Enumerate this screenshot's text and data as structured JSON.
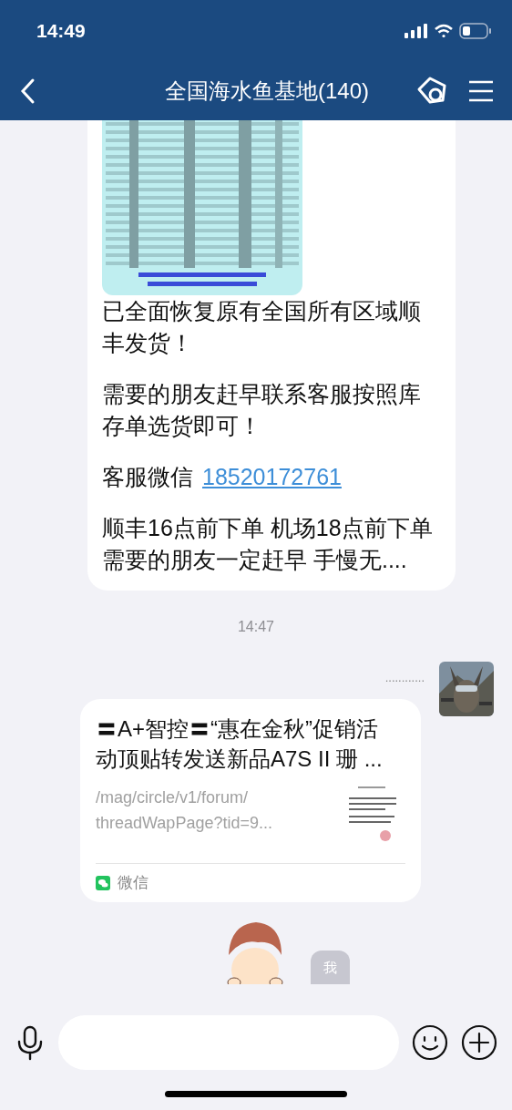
{
  "status_bar": {
    "time": "14:49"
  },
  "header": {
    "title": "全国海水鱼基地(140)"
  },
  "messages": [
    {
      "kind": "text",
      "paragraphs": [
        {
          "kind": "text",
          "text": "已全面恢复原有全国所有区域顺丰发货！"
        },
        {
          "kind": "text",
          "text": "需要的朋友赶早联系客服按照库存单选货即可！"
        },
        {
          "kind": "contact",
          "text": "客服微信",
          "link": "18520172761"
        },
        {
          "kind": "lines",
          "lines": [
            "顺丰16点前下单 机场18点前下单",
            "需要的朋友一定赶早 手慢无...."
          ]
        }
      ]
    },
    {
      "kind": "time",
      "text": "14:47"
    },
    {
      "kind": "link",
      "sender": "............",
      "title": "〓A+智控〓“惠在金秋”促销活动顶贴转发送新品A7S II 珊 ...",
      "url_lines": [
        "/mag/circle/v1/forum/",
        "threadWapPage?tid=9..."
      ],
      "source": "微信"
    },
    {
      "kind": "sticker",
      "label": "我"
    }
  ]
}
